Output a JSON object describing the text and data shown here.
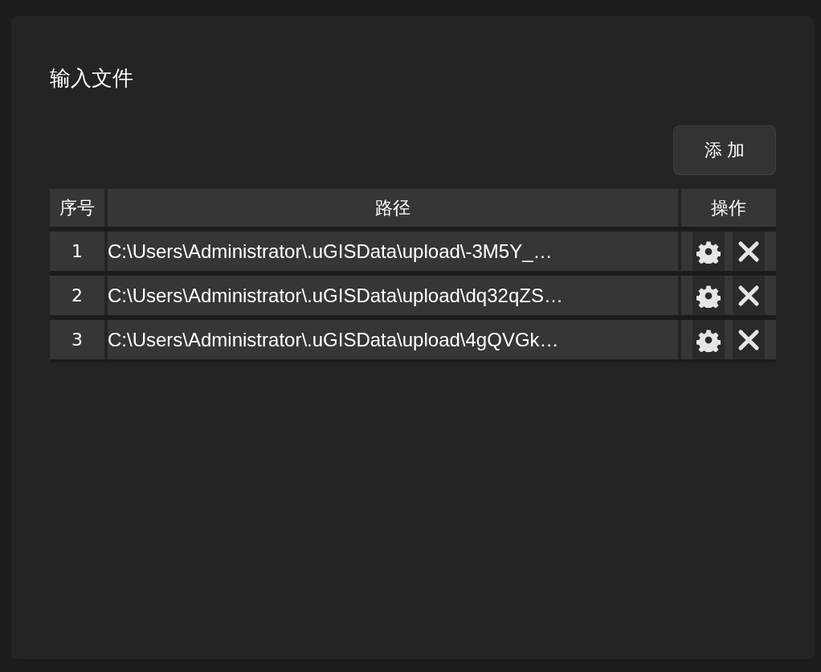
{
  "dialog": {
    "title": "输入文件"
  },
  "add_button": {
    "label": "添 加"
  },
  "table": {
    "columns": [
      "序号",
      "路径",
      "操作"
    ],
    "rows": [
      {
        "index": "1",
        "path": "C:\\Users\\Administrator\\.uGISData\\upload\\-3M5Y_…"
      },
      {
        "index": "2",
        "path": "C:\\Users\\Administrator\\.uGISData\\upload\\dq32qZS…"
      },
      {
        "index": "3",
        "path": "C:\\Users\\Administrator\\.uGISData\\upload\\4gQVGk…"
      }
    ]
  }
}
